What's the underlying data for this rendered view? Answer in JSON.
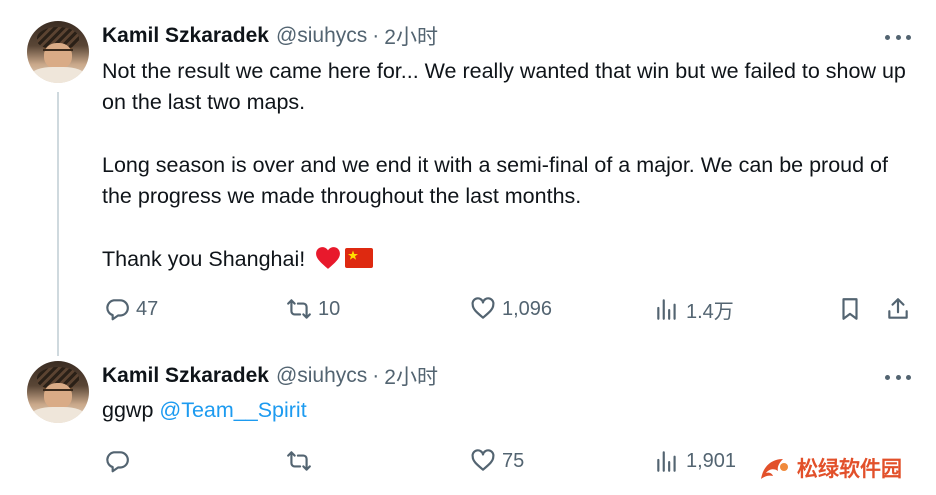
{
  "tweets": [
    {
      "author_name": "Kamil Szkaradek",
      "handle": "@siuhycs",
      "separator": "·",
      "time": "2小时",
      "paragraphs": [
        "Not the result we came here for... We really wanted that win but we failed to show up on the last two maps.",
        "Long season is over and we end it with a semi-final of a major. We can be proud of the progress we made throughout the last months.",
        "Thank you Shanghai!"
      ],
      "emoji": [
        "red-heart",
        "china-flag"
      ],
      "replies": "47",
      "retweets": "10",
      "likes": "1,096",
      "views": "1.4万"
    },
    {
      "author_name": "Kamil Szkaradek",
      "handle": "@siuhycs",
      "separator": "·",
      "time": "2小时",
      "text_prefix": "ggwp ",
      "mention": "@Team__Spirit",
      "replies": "",
      "retweets": "",
      "likes": "75",
      "views": "1,901"
    }
  ],
  "icons": {
    "reply": "reply-icon",
    "retweet": "retweet-icon",
    "like": "heart-icon",
    "views": "views-icon",
    "bookmark": "bookmark-icon",
    "share": "share-icon",
    "more": "more-icon"
  },
  "colors": {
    "text": "#0f1419",
    "secondary": "#536471",
    "link": "#1d9bf0",
    "heart": "#e8192c",
    "watermark": "#e2502a"
  },
  "watermark": {
    "text": "松绿软件园"
  }
}
